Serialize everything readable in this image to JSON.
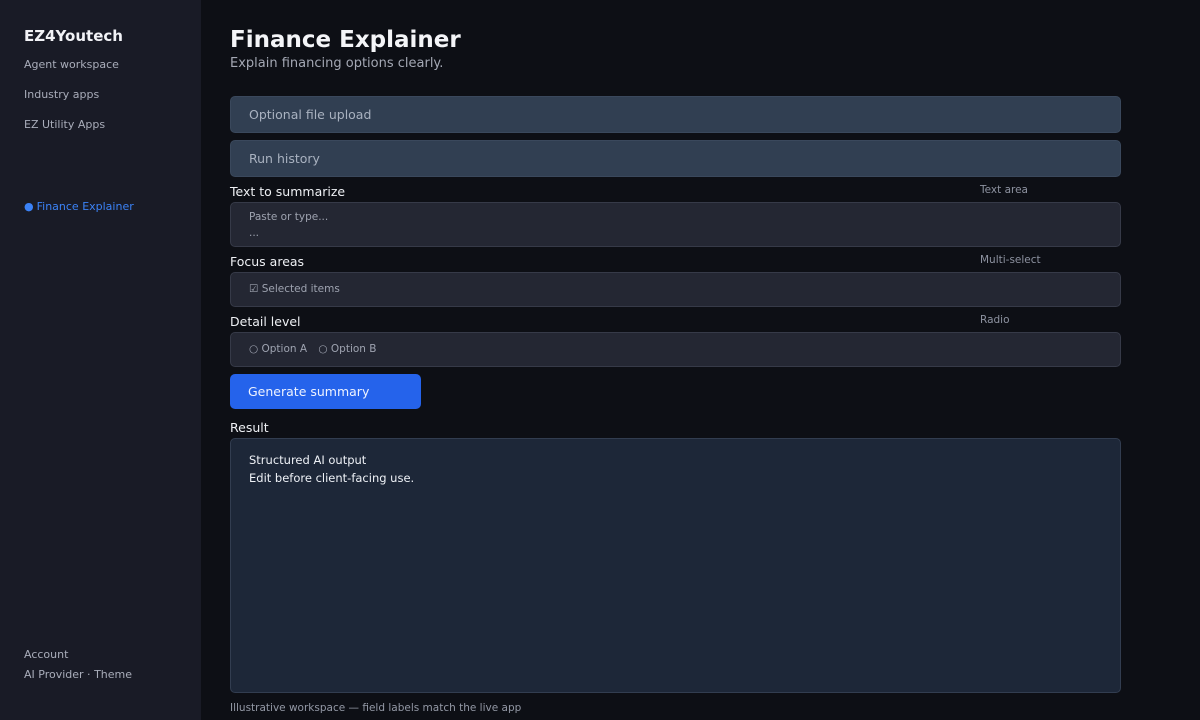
{
  "sidebar": {
    "brand": "EZ4Youtech",
    "nav": [
      {
        "label": "Agent workspace"
      },
      {
        "label": "Industry apps"
      },
      {
        "label": "EZ Utility Apps"
      }
    ],
    "active_item": {
      "dot": "●",
      "label": "Finance Explainer"
    },
    "footer": {
      "account": "Account",
      "ai_provider": "AI Provider",
      "separator": " · ",
      "theme": "Theme"
    }
  },
  "main": {
    "title": "Finance Explainer",
    "subtitle": "Explain financing options clearly.",
    "expanders": [
      {
        "label": "Optional file upload"
      },
      {
        "label": "Run history"
      }
    ],
    "fields": {
      "text": {
        "label": "Text to summarize",
        "type": "Text area",
        "placeholder": "Paste or type...",
        "placeholder_more": "..."
      },
      "focus": {
        "label": "Focus areas",
        "type": "Multi-select",
        "value": "☑ Selected items"
      },
      "detail": {
        "label": "Detail level",
        "type": "Radio",
        "options": [
          "○ Option A",
          "○ Option B"
        ]
      }
    },
    "generate_button": "Generate summary",
    "result": {
      "label": "Result",
      "lines": [
        "Structured AI output",
        "Edit before client-facing use."
      ]
    },
    "footnote": "Illustrative workspace — field labels match the live app"
  },
  "colors": {
    "background": "#0d0f15",
    "sidebar": "#191b26",
    "accent": "#2563eb",
    "active_nav": "#3b82f6"
  }
}
